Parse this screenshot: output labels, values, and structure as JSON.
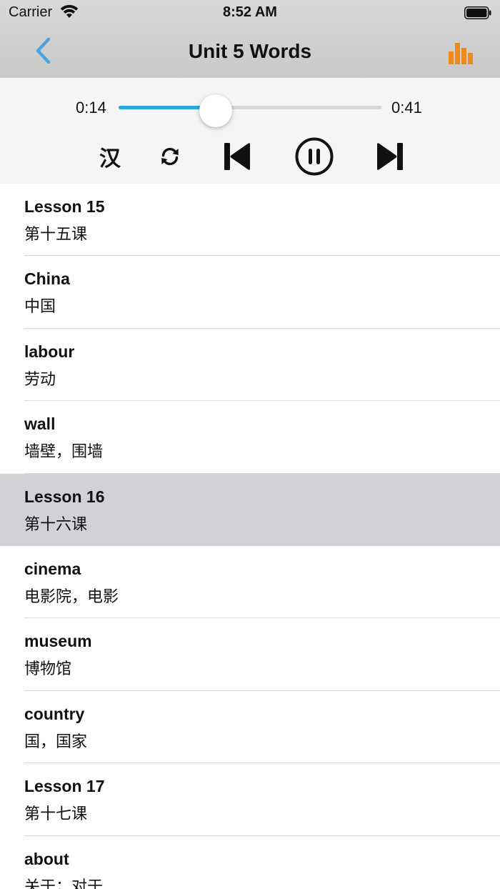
{
  "status_bar": {
    "carrier": "Carrier",
    "time": "8:52 AM",
    "icons": [
      "wifi-icon",
      "battery-icon"
    ]
  },
  "nav": {
    "title": "Unit 5 Words",
    "back_icon": "chevron-left-icon",
    "stats_icon": "bar-chart-icon"
  },
  "colors": {
    "accent_blue": "#2aa8e0",
    "back_blue": "#4aa3e3",
    "stats_orange": "#f08a1c",
    "selected_row": "#d1d1d6"
  },
  "player": {
    "current_time": "0:14",
    "duration": "0:41",
    "progress_fraction": 0.37,
    "language_toggle_label": "汉",
    "controls": [
      "language-toggle",
      "repeat-icon",
      "previous-track-icon",
      "pause-icon",
      "next-track-icon"
    ]
  },
  "words": [
    {
      "en": "Lesson 15",
      "zh": "第十五课",
      "selected": false
    },
    {
      "en": "China",
      "zh": "中国",
      "selected": false
    },
    {
      "en": "labour",
      "zh": "劳动",
      "selected": false
    },
    {
      "en": "wall",
      "zh": "墙壁，围墙",
      "selected": false
    },
    {
      "en": "Lesson 16",
      "zh": "第十六课",
      "selected": true
    },
    {
      "en": "cinema",
      "zh": "电影院，电影",
      "selected": false
    },
    {
      "en": "museum",
      "zh": "博物馆",
      "selected": false
    },
    {
      "en": "country",
      "zh": "国，国家",
      "selected": false
    },
    {
      "en": "Lesson 17",
      "zh": "第十七课",
      "selected": false
    },
    {
      "en": "about",
      "zh": "关于；对于",
      "selected": false
    }
  ]
}
